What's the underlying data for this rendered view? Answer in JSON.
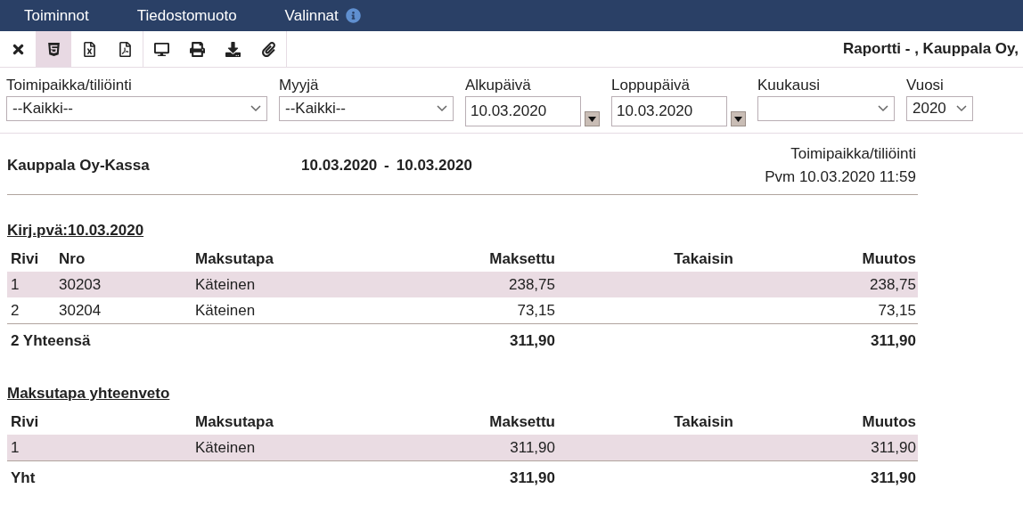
{
  "menu": [
    {
      "label": "Toiminnot",
      "info": false
    },
    {
      "label": "Tiedostomuoto",
      "info": false
    },
    {
      "label": "Valinnat",
      "info": true
    }
  ],
  "toolbar": [
    {
      "group": [
        {
          "kind": "close",
          "selected": false
        },
        {
          "kind": "html",
          "selected": true
        },
        {
          "kind": "excel",
          "selected": false
        },
        {
          "kind": "pdf",
          "selected": false
        }
      ]
    },
    {
      "group": [
        {
          "kind": "screen",
          "selected": false
        },
        {
          "kind": "print",
          "selected": false
        },
        {
          "kind": "download",
          "selected": false
        },
        {
          "kind": "attach",
          "selected": false
        }
      ]
    }
  ],
  "report_title": "Raportti - , Kauppala Oy,",
  "filters": [
    {
      "kind": "select",
      "label": "Toimipaikka/tiliöinti",
      "value": "--Kaikki--"
    },
    {
      "kind": "select",
      "label": "Myyjä",
      "value": "--Kaikki--"
    },
    {
      "kind": "date",
      "label": "Alkupäivä",
      "value": "10.03.2020"
    },
    {
      "kind": "date",
      "label": "Loppupäivä",
      "value": "10.03.2020"
    },
    {
      "kind": "select",
      "label": "Kuukausi"
    },
    {
      "kind": "select",
      "label": "Vuosi",
      "value": "2020"
    }
  ],
  "report": {
    "company": "Kauppala Oy-Kassa",
    "date_from": "10.03.2020",
    "separator": "-",
    "date_to": "10.03.2020",
    "meta": [
      "Toimipaikka/tiliöinti",
      "Pvm 10.03.2020 11:59"
    ],
    "sections": [
      {
        "heading": "Kirj.pvä:10.03.2020",
        "columns": [
          "Rivi",
          "Nro",
          "Maksutapa",
          "Maksettu",
          "Takaisin",
          "Muutos"
        ],
        "rows": [
          [
            "1",
            "30203",
            "Käteinen",
            "238,75",
            null,
            "238,75"
          ],
          [
            "2",
            "30204",
            "Käteinen",
            "73,15",
            null,
            "73,15"
          ]
        ],
        "total": {
          "label": "2 Yhteensä",
          "paid": "311,90",
          "change": "311,90"
        }
      },
      {
        "heading": "Maksutapa yhteenveto",
        "columns": [
          "Rivi",
          null,
          "Maksutapa",
          "Maksettu",
          "Takaisin",
          "Muutos"
        ],
        "rows": [
          [
            "1",
            null,
            "Käteinen",
            "311,90",
            null,
            "311,90"
          ]
        ],
        "total": {
          "label": "Yht",
          "paid": "311,90",
          "change": "311,90"
        }
      }
    ]
  }
}
